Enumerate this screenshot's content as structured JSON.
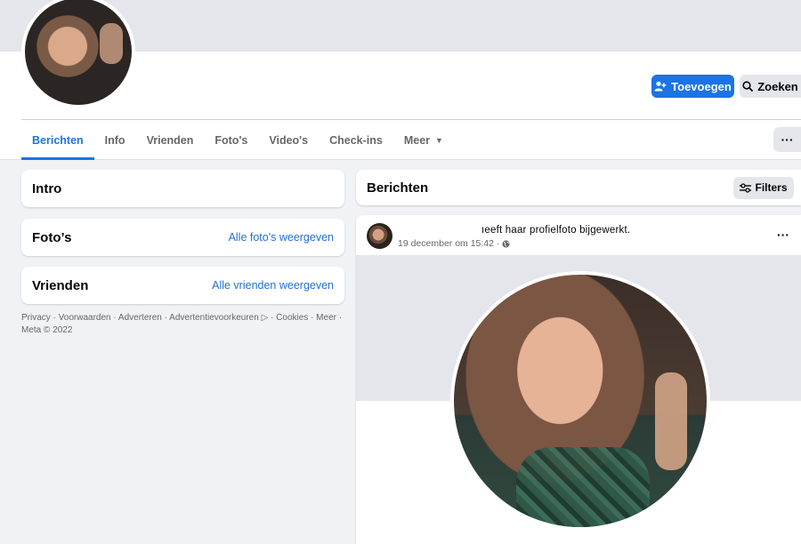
{
  "header": {
    "add_button_label": "Toevoegen",
    "search_button_label": "Zoeken"
  },
  "tabs": [
    {
      "label": "Berichten",
      "active": true
    },
    {
      "label": "Info"
    },
    {
      "label": "Vrienden"
    },
    {
      "label": "Foto's"
    },
    {
      "label": "Video's"
    },
    {
      "label": "Check-ins"
    },
    {
      "label": "Meer",
      "has_caret": true
    }
  ],
  "more_button_label": "···",
  "left": {
    "intro_title": "Intro",
    "photos_title": "Foto’s",
    "photos_link": "Alle foto's weergeven",
    "friends_title": "Vrienden",
    "friends_link": "Alle vrienden weergeven",
    "footer_text": "Privacy · Voorwaarden · Adverteren · Advertentievoorkeuren ▷ · Cookies · Meer · Meta © 2022"
  },
  "posts": {
    "title": "Berichten",
    "filters_label": "Filters",
    "headline": "ıeeft haar profielfoto bijgewerkt.",
    "timestamp": "19 december om 15:42 ·",
    "menu_label": "···"
  },
  "colors": {
    "primary": "#1b74e4",
    "link": "#216fdb",
    "background": "#f0f2f5",
    "muted": "#65676b"
  },
  "icons": {
    "add": "person-plus-icon",
    "search": "search-icon",
    "filters": "sliders-icon",
    "globe": "globe-icon"
  }
}
